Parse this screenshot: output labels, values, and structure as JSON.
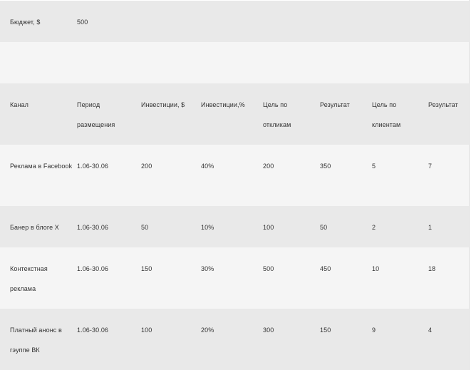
{
  "budget": {
    "label": "Бюджет, $",
    "value": "500"
  },
  "table": {
    "headers": [
      "Канал",
      "Период размещения",
      "Инвестиции, $",
      "Инвестиции,%",
      "Цель по откликам",
      "Результат",
      "Цель по клиентам",
      "Результат"
    ],
    "rows": [
      [
        "Реклама в Facebook",
        "1.06-30.06",
        "200",
        "40%",
        "200",
        "350",
        "5",
        "7"
      ],
      [
        "Банер в блоге Х",
        "1.06-30.06",
        "50",
        "10%",
        "100",
        "50",
        "2",
        "1"
      ],
      [
        "Контекстная реклама",
        "1.06-30.06",
        "150",
        "30%",
        "500",
        "450",
        "10",
        "18"
      ],
      [
        "Платный анонс в гэуппе ВК",
        "1.06-30.06",
        "100",
        "20%",
        "300",
        "150",
        "9",
        "4"
      ]
    ]
  },
  "colors": {
    "row_dark": "#e9e9e9",
    "row_light": "#f5f5f5",
    "text": "#333333"
  }
}
